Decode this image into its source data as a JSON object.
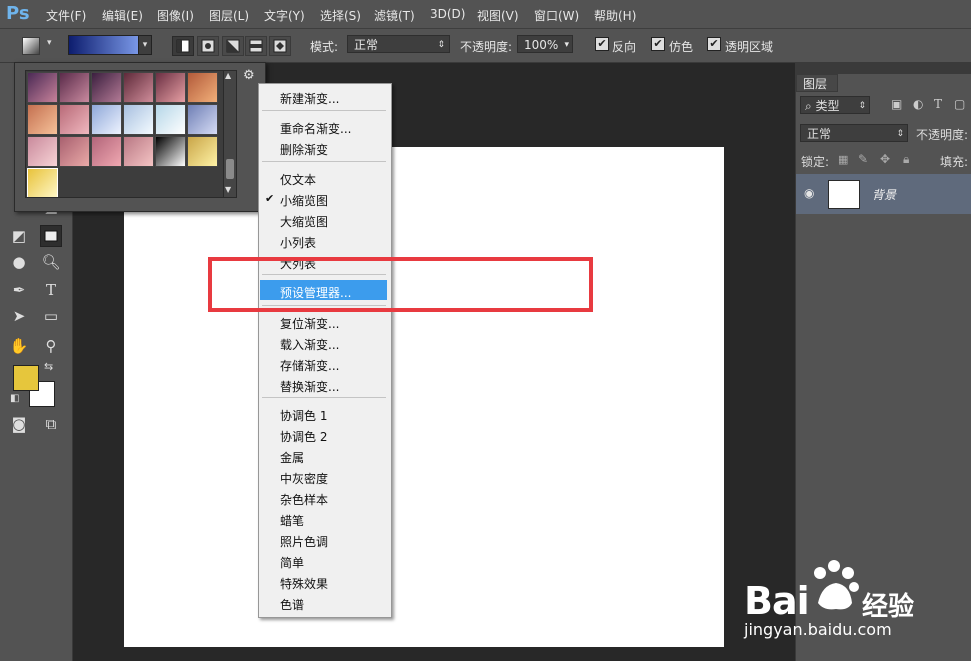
{
  "app": {
    "logo": "Ps",
    "menus": [
      "文件(F)",
      "编辑(E)",
      "图像(I)",
      "图层(L)",
      "文字(Y)",
      "选择(S)",
      "滤镜(T)",
      "3D(D)",
      "视图(V)",
      "窗口(W)",
      "帮助(H)"
    ]
  },
  "options": {
    "mode_label": "模式:",
    "mode_value": "正常",
    "opacity_label": "不透明度:",
    "opacity_value": "100%",
    "reverse_label": "反向",
    "dither_label": "仿色",
    "transparency_label": "透明区域"
  },
  "picker": {
    "gear_icon": "gear-icon",
    "swatches": [
      "linear-gradient(135deg,#4b2a55,#c7829a)",
      "linear-gradient(135deg,#5a2b4a,#c98a9f)",
      "linear-gradient(135deg,#3b1f3f,#b37a95)",
      "linear-gradient(135deg,#5e2a3a,#d08d9a)",
      "linear-gradient(135deg,#6a2f43,#e7a0a4)",
      "linear-gradient(135deg,#b25a3a,#f2b07a)",
      "linear-gradient(135deg,#c47050,#f6c29a)",
      "linear-gradient(135deg,#b86a78,#f0b8bf)",
      "linear-gradient(135deg,#8fa8d8,#eef3ff)",
      "linear-gradient(135deg,#a8c0e0,#f4fbff)",
      "linear-gradient(135deg,#b5d6e8,#ffffff)",
      "linear-gradient(135deg,#6f7fb5,#d6dcf5)",
      "linear-gradient(135deg,#c98a9c,#f7d3d6)",
      "linear-gradient(135deg,#a8606f,#eaaaa8)",
      "linear-gradient(135deg,#b2657a,#f0a8b1)",
      "linear-gradient(135deg,#b97884,#f4c4c4)",
      "linear-gradient(135deg,#000000,#ffffff)",
      "linear-gradient(135deg,#c9a548,#fff3a6)",
      "linear-gradient(135deg,#e8c23a,#fff8c8)"
    ]
  },
  "context_menu": {
    "new_gradient": "新建渐变...",
    "rename_gradient": "重命名渐变...",
    "delete_gradient": "删除渐变",
    "text_only": "仅文本",
    "small_thumbnail": "小缩览图",
    "large_thumbnail": "大缩览图",
    "small_list": "小列表",
    "large_list": "大列表",
    "preset_manager": "预设管理器...",
    "reset_gradients": "复位渐变...",
    "load_gradients": "载入渐变...",
    "save_gradients": "存储渐变...",
    "replace_gradients": "替换渐变...",
    "sets": [
      "协调色 1",
      "协调色 2",
      "金属",
      "中灰密度",
      "杂色样本",
      "蜡笔",
      "照片色调",
      "简单",
      "特殊效果",
      "色谱"
    ]
  },
  "layers": {
    "tab": "图层",
    "filter_label": "类型",
    "blend_value": "正常",
    "opacity_label": "不透明度:",
    "lock_label": "锁定:",
    "fill_label": "填充:",
    "layer_name": "背景"
  },
  "colors": {
    "foreground": "#e6c63c",
    "background": "#ffffff",
    "highlight": "#3c9ced",
    "annotation": "#e83a40"
  },
  "watermark": {
    "brand": "Bai",
    "suffix": "经验",
    "url": "jingyan.baidu.com"
  }
}
